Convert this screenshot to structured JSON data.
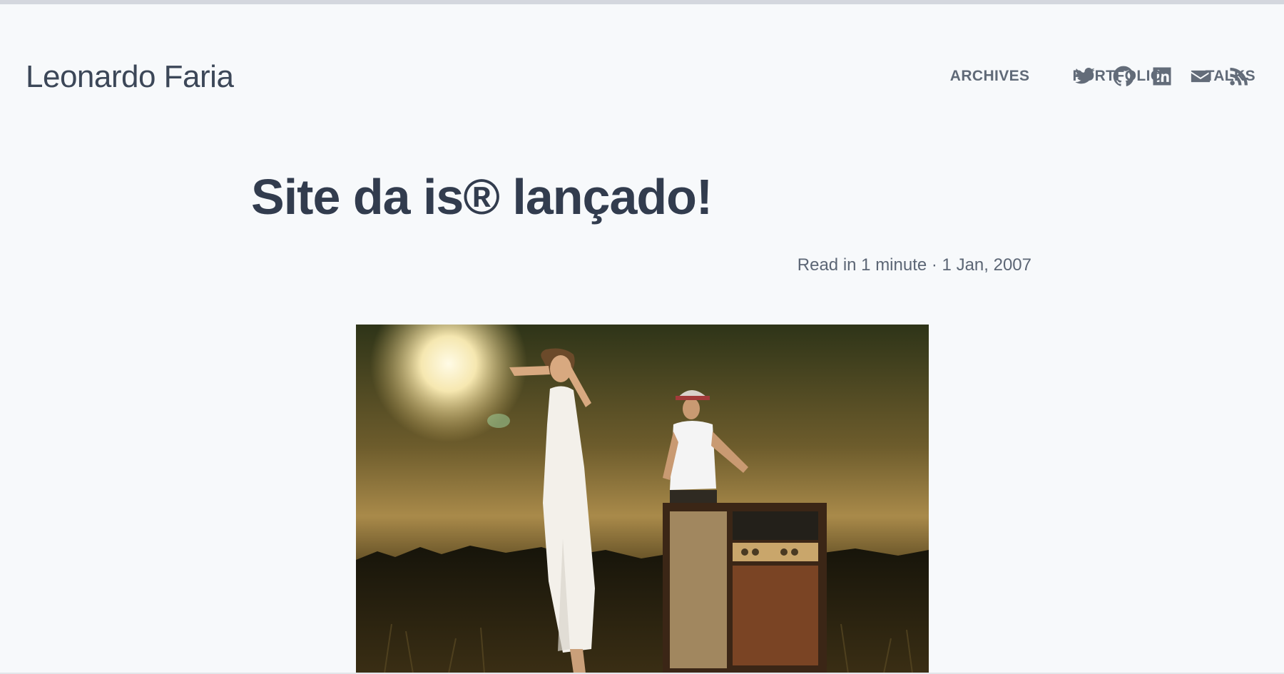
{
  "site": {
    "name": "Leonardo Faria"
  },
  "nav": {
    "items": [
      {
        "label": "ARCHIVES"
      },
      {
        "label": "PORTFOLIO"
      },
      {
        "label": "TALKS"
      }
    ]
  },
  "social": {
    "icons": [
      "twitter-icon",
      "github-icon",
      "linkedin-icon",
      "email-icon",
      "rss-icon"
    ],
    "icon_color": "#636c79"
  },
  "post": {
    "title": "Site da is® lançado!",
    "meta": "Read in 1 minute · 1 Jan, 2007"
  },
  "colors": {
    "background": "#f7f9fb",
    "title": "#323c4e",
    "nav_text": "#606a78",
    "top_bar": "#d4d7de"
  }
}
